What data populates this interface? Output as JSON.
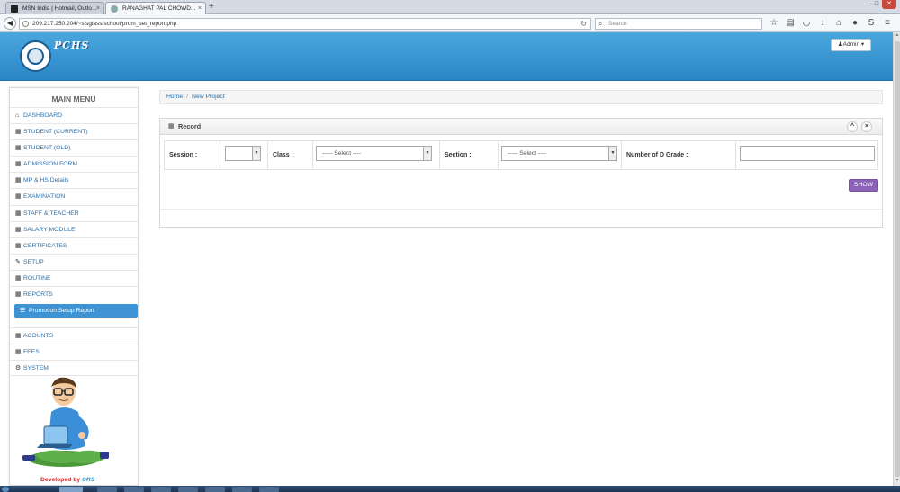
{
  "browser": {
    "tabs": [
      {
        "title": "MSN India | Hotmail, Outlo...",
        "active": false
      },
      {
        "title": "RANAGHAT PAL CHOWD...",
        "active": true
      }
    ],
    "url": "209.217.250.204/~sisglass/school/prom_set_report.php",
    "search_placeholder": "Search",
    "new_tab": "+",
    "close_glyph": "×"
  },
  "header": {
    "brand": "PCHS",
    "admin_label": "Admin",
    "accent": "#2a86c5"
  },
  "sidebar": {
    "title": "MAIN MENU",
    "items": [
      {
        "label": "DASHBOARD",
        "icon": "home-icon"
      },
      {
        "label": "STUDENT (CURRENT)",
        "icon": "grid-icon"
      },
      {
        "label": "STUDENT (OLD)",
        "icon": "grid-icon"
      },
      {
        "label": "ADMISSION FORM",
        "icon": "grid-icon"
      },
      {
        "label": "MP & HS Details",
        "icon": "grid-icon"
      },
      {
        "label": "EXAMINATION",
        "icon": "grid-icon"
      },
      {
        "label": "STAFF & TEACHER",
        "icon": "grid-icon"
      },
      {
        "label": "SALARY MODULE",
        "icon": "grid-icon"
      },
      {
        "label": "CERTIFICATES",
        "icon": "grid-icon"
      },
      {
        "label": "SETUP",
        "icon": "wrench-icon"
      },
      {
        "label": "ROUTINE",
        "icon": "grid-icon"
      },
      {
        "label": "REPORTS",
        "icon": "grid-icon"
      },
      {
        "label": "Promotion Setup Report",
        "icon": "list-icon"
      },
      {
        "label": "ACOUNTS",
        "icon": "grid-icon"
      },
      {
        "label": "FEES",
        "icon": "grid-icon"
      },
      {
        "label": "SYSTEM",
        "icon": "cogs-icon"
      }
    ],
    "developed_by": "Developed by",
    "developer": "ons"
  },
  "breadcrumb": {
    "home": "Home",
    "separator": "/",
    "current": "New Project"
  },
  "panel": {
    "title": "Record",
    "session_label": "Session :",
    "session_value": "",
    "class_label": "Class :",
    "class_value": "----- Select ----",
    "section_label": "Section :",
    "section_value": "----- Select ----",
    "dgrade_label": "Number of D Grade :",
    "dgrade_value": "",
    "show_button": "SHOW",
    "collapse_glyph": "^",
    "close_glyph": "×"
  }
}
